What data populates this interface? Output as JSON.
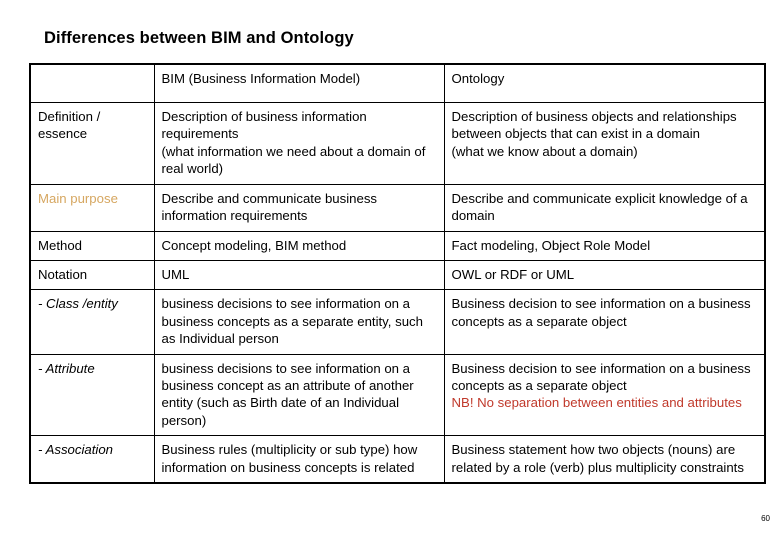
{
  "slide": {
    "title": "Differences between BIM and Ontology",
    "page_number": "60"
  },
  "table": {
    "header": {
      "corner": "",
      "col_bim": "BIM (Business Information Model)",
      "col_ontology": "Ontology"
    },
    "rows": [
      {
        "label": "Definition / essence",
        "label_style": "plain",
        "bim": [
          "Description of business information requirements",
          "(what information we need about a domain of real world)"
        ],
        "ontology": [
          "Description  of business objects and relationships between objects that can exist in a domain",
          "(what we know about a domain)"
        ]
      },
      {
        "label": "Main purpose",
        "label_style": "orange",
        "bim": [
          "Describe and communicate business information requirements"
        ],
        "ontology": [
          "Describe and communicate explicit knowledge of a domain"
        ]
      },
      {
        "label": "Method",
        "label_style": "plain",
        "bim": [
          "Concept modeling, BIM method"
        ],
        "ontology": [
          "Fact modeling, Object Role Model"
        ]
      },
      {
        "label": "Notation",
        "label_style": "plain",
        "bim": [
          "UML"
        ],
        "ontology": [
          "OWL or RDF or UML"
        ]
      },
      {
        "label": "- Class /entity",
        "label_style": "italic",
        "bim": [
          "business decisions to see information on a business concepts as a separate entity, such as Individual person"
        ],
        "ontology": [
          "Business decision to see information on a business concepts as a separate object"
        ]
      },
      {
        "label": "- Attribute",
        "label_style": "italic",
        "bim": [
          "business decisions to see information on a business concept as an attribute of another entity (such as Birth date of an Individual person)"
        ],
        "ontology": [
          "Business decision to see information on a business concepts as a separate object"
        ],
        "ontology_note": "NB! No separation between entities and attributes"
      },
      {
        "label": "- Association",
        "label_style": "italic",
        "bim": [
          "Business rules (multiplicity or sub type) how information on business concepts is related"
        ],
        "ontology": [
          "Business statement how two objects (nouns) are related by a role (verb) plus multiplicity constraints"
        ]
      }
    ]
  },
  "colors": {
    "accent_orange": "#D6A761",
    "accent_red": "#C0392B",
    "border": "#000000",
    "text": "#000000",
    "background": "#FFFFFF"
  }
}
